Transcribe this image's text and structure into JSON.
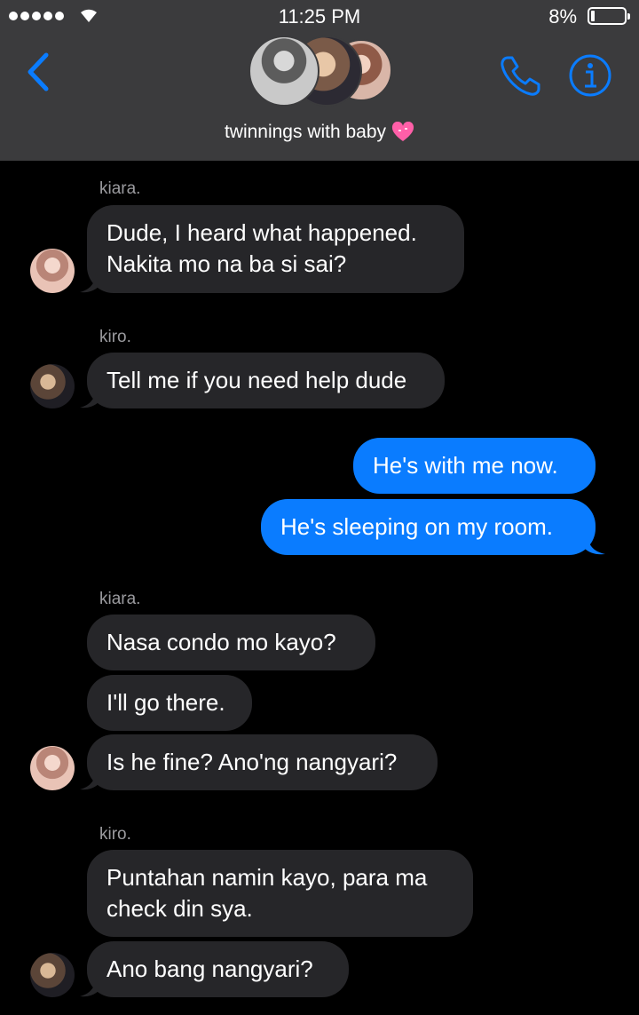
{
  "status_bar": {
    "time": "11:25 PM",
    "battery_percent": "8%",
    "battery_level": 0.08
  },
  "nav": {
    "back_icon": "chevron-left-icon",
    "call_icon": "phone-icon",
    "info_icon": "info-icon",
    "accent_color": "#0a7cff"
  },
  "conversation": {
    "title": "twinnings with baby",
    "title_emoji": "heart-icon"
  },
  "messages": {
    "s1": "kiara.",
    "m1a": "Dude, I heard what happened.",
    "m1b": "Nakita mo na ba si sai?",
    "s2": "kiro.",
    "m2": "Tell me if you need help dude",
    "m3": "He's with me now.",
    "m4": "He's sleeping on my room.",
    "s3": "kiara.",
    "m5": "Nasa condo mo kayo?",
    "m6": "I'll go there.",
    "m7": "Is he fine? Ano'ng nangyari?",
    "s4": "kiro.",
    "m8a": "Puntahan namin kayo, para ma",
    "m8b": "check din sya.",
    "m9": "Ano bang nangyari?"
  }
}
